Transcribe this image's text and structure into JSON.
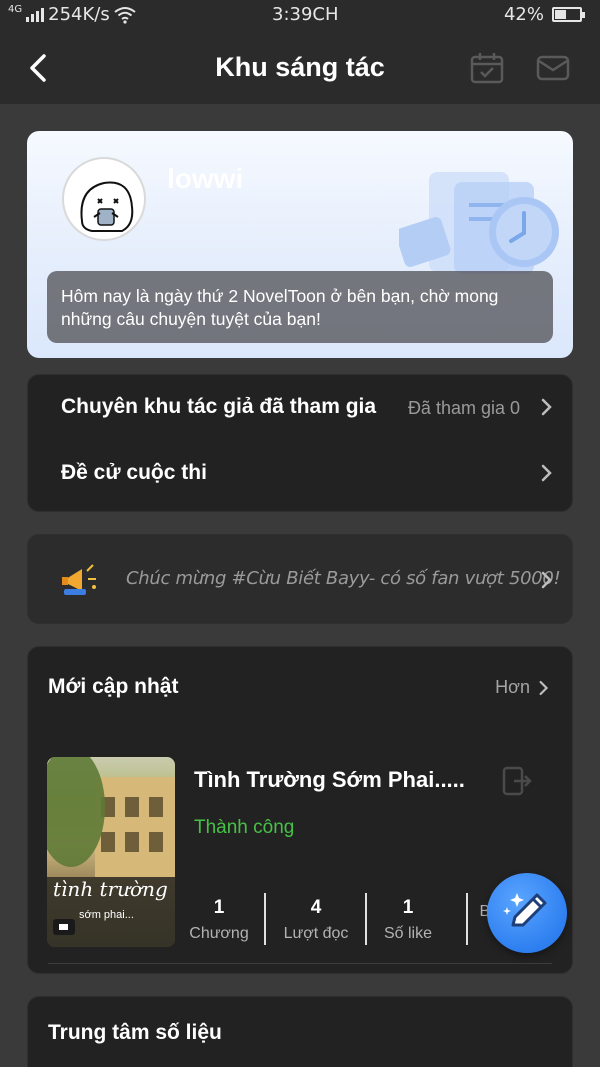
{
  "status_bar": {
    "network": "4G",
    "speed": "254K/s",
    "time": "3:39CH",
    "battery": "42%",
    "battery_level": 0.42
  },
  "header": {
    "title": "Khu sáng tác",
    "back_icon": "chevron-left-icon",
    "calendar_icon": "calendar-check-icon",
    "mail_icon": "mail-icon"
  },
  "profile": {
    "username": "lowwi",
    "greeting": "Hôm nay là ngày thứ 2 NovelToon ở bên bạn, chờ mong những câu chuyện tuyệt của bạn!"
  },
  "menu": {
    "items": [
      {
        "label": "Chuyên khu tác giả đã tham gia",
        "value": "Đã tham gia 0"
      },
      {
        "label": "Đề cử cuộc thi",
        "value": ""
      }
    ]
  },
  "announcement": {
    "icon": "megaphone-icon",
    "text": "Chúc mừng #Cừu Biết Bayy- có số fan vượt 5000!"
  },
  "recent": {
    "title": "Mới cập nhật",
    "more_label": "Hơn",
    "book": {
      "title": "Tình Trường Sớm Phai.....",
      "status": "Thành công",
      "status_color": "#46c146",
      "cover_title": "tình trường",
      "cover_subtitle": "sớm phai...",
      "stats": [
        {
          "value": "1",
          "label": "Chương"
        },
        {
          "value": "4",
          "label": "Lượt đọc"
        },
        {
          "value": "1",
          "label": "Số like"
        },
        {
          "value": "",
          "label": "Bình"
        }
      ]
    }
  },
  "data_center": {
    "title": "Trung tâm số liệu"
  },
  "fab": {
    "icon": "pencil-sparkle-icon"
  },
  "colors": {
    "accent": "#2e7ff0",
    "success": "#46c146",
    "card": "#222222",
    "background": "#3a3a3a"
  }
}
